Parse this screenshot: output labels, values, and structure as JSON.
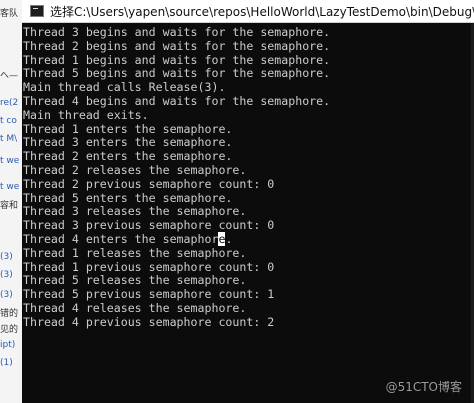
{
  "background": {
    "lines": [
      {
        "text": "客队",
        "color": "#333333"
      },
      {
        "text": "へ—",
        "color": "#333333"
      },
      {
        "text": "re(2",
        "color": "#2a5db0"
      },
      {
        "text": "t co",
        "color": "#2a5db0"
      },
      {
        "text": "t M\\",
        "color": "#2a5db0"
      },
      {
        "text": "t we",
        "color": "#2a5db0"
      },
      {
        "text": "t we",
        "color": "#2a5db0"
      },
      {
        "text": "容和",
        "color": "#333333"
      },
      {
        "text": "(3)",
        "color": "#2a5db0"
      },
      {
        "text": "(3)",
        "color": "#2a5db0"
      },
      {
        "text": "(3)",
        "color": "#2a5db0"
      },
      {
        "text": "错的",
        "color": "#333333"
      },
      {
        "text": "见的",
        "color": "#333333"
      },
      {
        "text": "ipt)",
        "color": "#2a5db0"
      },
      {
        "text": "(1)",
        "color": "#2a5db0"
      }
    ]
  },
  "window": {
    "title": "选择C:\\Users\\yapen\\source\\repos\\HelloWorld\\LazyTestDemo\\bin\\Debug\\LazyTestDemo",
    "icon": "console-app-icon"
  },
  "console": {
    "text_color": "#cccccc",
    "background_color": "#0c0c0c",
    "lines": [
      "Thread 3 begins and waits for the semaphore.",
      "Thread 2 begins and waits for the semaphore.",
      "Thread 1 begins and waits for the semaphore.",
      "Thread 5 begins and waits for the semaphore.",
      "Main thread calls Release(3).",
      "Thread 4 begins and waits for the semaphore.",
      "Main thread exits.",
      "Thread 1 enters the semaphore.",
      "Thread 3 enters the semaphore.",
      "Thread 2 enters the semaphore.",
      "Thread 2 releases the semaphore.",
      "Thread 2 previous semaphore count: 0",
      "Thread 5 enters the semaphore.",
      "Thread 3 releases the semaphore.",
      "Thread 3 previous semaphore count: 0",
      "Thread 4 enters the semaphore.",
      "Thread 1 releases the semaphore.",
      "Thread 1 previous semaphore count: 0",
      "Thread 5 releases the semaphore.",
      "Thread 5 previous semaphore count: 1",
      "Thread 4 releases the semaphore.",
      "Thread 4 previous semaphore count: 2"
    ],
    "selection": {
      "line": 15,
      "char_index": 28
    }
  },
  "watermark": "@51CTO博客"
}
